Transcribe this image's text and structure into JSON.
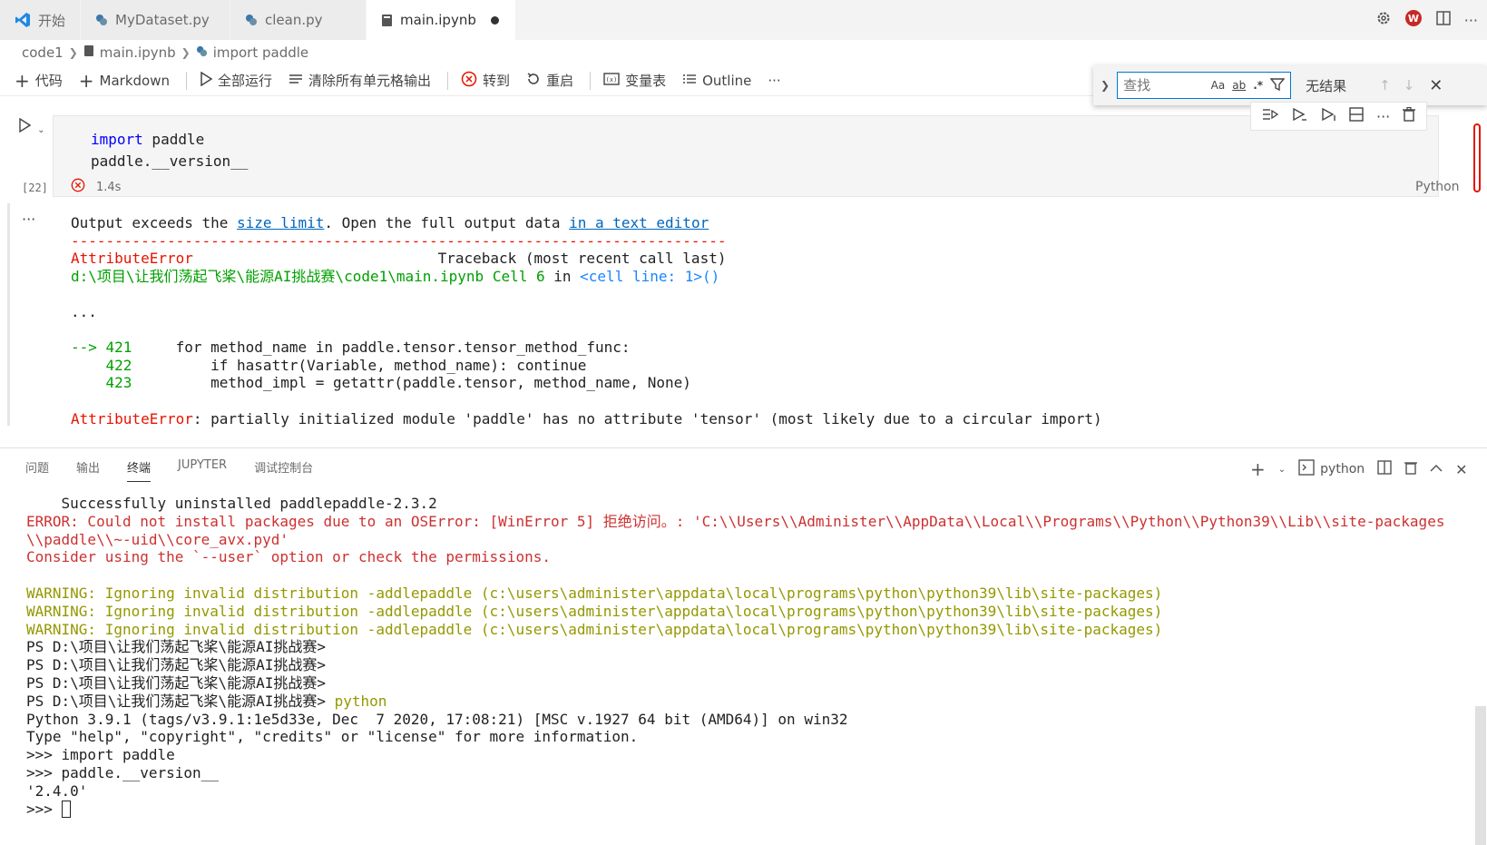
{
  "tabs": [
    {
      "label": "开始",
      "icon": "vscode-icon"
    },
    {
      "label": "MyDataset.py",
      "icon": "python-icon"
    },
    {
      "label": "clean.py",
      "icon": "python-icon"
    },
    {
      "label": "main.ipynb",
      "icon": "notebook-icon",
      "active": true
    }
  ],
  "breadcrumb": [
    "code1",
    "main.ipynb",
    "import paddle"
  ],
  "toolbar": {
    "code": "代码",
    "markdown": "Markdown",
    "run_all": "全部运行",
    "clear_outputs": "清除所有单元格输出",
    "goto": "转到",
    "restart": "重启",
    "variables": "变量表",
    "outline": "Outline",
    "more": "···"
  },
  "find": {
    "placeholder": "查找",
    "match_case": "Aa",
    "whole_word": "ab",
    "regex": ".*",
    "result": "无结果"
  },
  "cell": {
    "code_line1_kw": "import",
    "code_line1_rest": " paddle",
    "code_line2": "paddle.__version__",
    "exec_count": "[22]",
    "duration": "1.4s",
    "language": "Python"
  },
  "output": {
    "ellipsis": "···",
    "msg_prefix": "Output exceeds the ",
    "link1": "size limit",
    "msg_mid": ". Open the full output data ",
    "link2": "in a text editor",
    "dashes": "---------------------------------------------------------------------------",
    "err_name": "AttributeError",
    "traceback": "                            Traceback (most recent call last)",
    "path": "d:\\项目\\让我们荡起飞桨\\能源AI挑战赛\\code1\\main.ipynb Cell 6",
    "path_in": " in ",
    "cell_line": "<cell line: 1>()",
    "dots": "...",
    "arrow_line_no": "--> 421",
    "line421": "     for method_name in paddle.tensor.tensor_method_func:",
    "line422_no": "    422",
    "line422": "         if hasattr(Variable, method_name): continue",
    "line423_no": "    423",
    "line423": "         method_impl = getattr(paddle.tensor, method_name, None)",
    "final_err": "AttributeError",
    "final_msg": ": partially initialized module 'paddle' has no attribute 'tensor' (most likely due to a circular import)"
  },
  "panel": {
    "tabs": [
      "问题",
      "输出",
      "终端",
      "JUPYTER",
      "调试控制台"
    ],
    "active_tab": "终端",
    "shell": "python"
  },
  "terminal": {
    "lines": [
      {
        "cls": "",
        "text": "    Successfully uninstalled paddlepaddle-2.3.2"
      },
      {
        "cls": "t-red",
        "text": "ERROR: Could not install packages due to an OSError: [WinError 5] 拒绝访问。: 'C:\\\\Users\\\\Administer\\\\AppData\\\\Local\\\\Programs\\\\Python\\\\Python39\\\\Lib\\\\site-packages"
      },
      {
        "cls": "t-red",
        "text": "\\\\paddle\\\\~-uid\\\\core_avx.pyd'"
      },
      {
        "cls": "t-red",
        "text": "Consider using the `--user` option or check the permissions."
      },
      {
        "cls": "",
        "text": ""
      },
      {
        "cls": "t-yel",
        "text": "WARNING: Ignoring invalid distribution -addlepaddle (c:\\users\\administer\\appdata\\local\\programs\\python\\python39\\lib\\site-packages)"
      },
      {
        "cls": "t-yel",
        "text": "WARNING: Ignoring invalid distribution -addlepaddle (c:\\users\\administer\\appdata\\local\\programs\\python\\python39\\lib\\site-packages)"
      },
      {
        "cls": "t-yel",
        "text": "WARNING: Ignoring invalid distribution -addlepaddle (c:\\users\\administer\\appdata\\local\\programs\\python\\python39\\lib\\site-packages)"
      },
      {
        "cls": "",
        "text": "PS D:\\项目\\让我们荡起飞桨\\能源AI挑战赛>"
      },
      {
        "cls": "",
        "text": "PS D:\\项目\\让我们荡起飞桨\\能源AI挑战赛>"
      },
      {
        "cls": "",
        "text": "PS D:\\项目\\让我们荡起飞桨\\能源AI挑战赛>"
      },
      {
        "cls": "",
        "text": "PS D:\\项目\\让我们荡起飞桨\\能源AI挑战赛> ",
        "cmd": "python"
      },
      {
        "cls": "",
        "text": "Python 3.9.1 (tags/v3.9.1:1e5d33e, Dec  7 2020, 17:08:21) [MSC v.1927 64 bit (AMD64)] on win32"
      },
      {
        "cls": "",
        "text": "Type \"help\", \"copyright\", \"credits\" or \"license\" for more information."
      },
      {
        "cls": "",
        "text": ">>> import paddle"
      },
      {
        "cls": "",
        "text": ">>> paddle.__version__"
      },
      {
        "cls": "",
        "text": "'2.4.0'"
      }
    ],
    "prompt": ">>> "
  },
  "colors": {
    "error": "#e51400",
    "accent": "#0078d4",
    "warning": "#949800",
    "terminal_error": "#cd3131"
  }
}
